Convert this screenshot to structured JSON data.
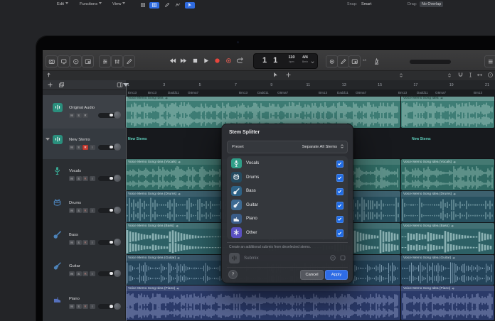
{
  "window": {
    "app": "Logic Pro"
  },
  "control_bar": {
    "transport": [
      "rewind",
      "fast-forward",
      "stop",
      "play",
      "record",
      "capture-record",
      "cycle"
    ],
    "lcd": {
      "position": "1 1",
      "tempo": "110",
      "tempo_unit": "bpm",
      "time_signature": "4/4",
      "key": "Bmin"
    },
    "count_in_label": "x4"
  },
  "menu_bar": {
    "menus": [
      "Edit",
      "Functions",
      "View"
    ],
    "snap_label": "Snap:",
    "snap_value": "Smart",
    "drag_label": "Drag:",
    "drag_value": "No Overlap"
  },
  "ruler": {
    "numbers": [
      "1",
      "3",
      "5",
      "7",
      "9",
      "11",
      "13",
      "15",
      "17",
      "19",
      "21"
    ]
  },
  "chord_track": {
    "labels": [
      "Em13",
      "Bm13",
      "Dadd11",
      "G6ma7",
      "Bm13",
      "Dadd11",
      "G6ma7",
      "Bm13",
      "Dadd11",
      "G6ma7",
      "Bm13",
      "Dadd11",
      "G6ma7",
      "Bm13"
    ]
  },
  "track_list": {
    "tracks": [
      {
        "name": "Original Audio",
        "icon": "audio",
        "tile_color": "#2a8f7d",
        "buttons": [
          "M",
          "S",
          "R"
        ],
        "selected": true
      },
      {
        "name": "New Stems",
        "icon": "audio",
        "tile_color": "#2a8f7d",
        "buttons": [
          "M",
          "S",
          "R",
          "I"
        ],
        "record_armed": true,
        "disclosure": true,
        "selected": true
      },
      {
        "name": "Vocals",
        "icon": "mic",
        "icon_color": "#38a893",
        "buttons": [
          "M",
          "S",
          "R",
          "I"
        ]
      },
      {
        "name": "Drums",
        "icon": "drum",
        "icon_color": "#4c82b8",
        "buttons": [
          "M",
          "S",
          "R",
          "I"
        ]
      },
      {
        "name": "Bass",
        "icon": "bass",
        "icon_color": "#4c82b8",
        "buttons": [
          "M",
          "S",
          "R",
          "I"
        ]
      },
      {
        "name": "Guitar",
        "icon": "guitar",
        "icon_color": "#4c82b8",
        "buttons": [
          "M",
          "S",
          "R",
          "I"
        ]
      },
      {
        "name": "Piano",
        "icon": "piano",
        "icon_color": "#5570bd",
        "buttons": [
          "M",
          "S",
          "R",
          "I"
        ]
      }
    ]
  },
  "arrange": {
    "rows": [
      {
        "label": "Voice Memo Song Idea",
        "color": "#3e7d75",
        "wave_color": "#a9cdc6"
      },
      {
        "label": "New Stems",
        "lane": true,
        "color": "#17191d",
        "text_color": "#5ecdbb"
      },
      {
        "label": "Voice Memo Song Idea (Vocals)",
        "color": "#2f6a63",
        "wave_color": "#9cc3bb"
      },
      {
        "label": "Voice Memo Song Idea (Drums)",
        "color": "#27505f",
        "wave_color": "#8fb2ba"
      },
      {
        "label": "Voice Memo Song Idea (Bass)",
        "color": "#2d6065",
        "wave_color": "#9cc0c1"
      },
      {
        "label": "Voice Memo Song Idea (Guitar)",
        "color": "#24445a",
        "wave_color": "#8aa8bd"
      },
      {
        "label": "Voice Memo Song Idea (Piano)",
        "color": "#2b3a69",
        "wave_color": "#95a2cd"
      }
    ]
  },
  "dialog": {
    "title": "Stem Splitter",
    "preset_label": "Preset",
    "preset_value": "Separate All Stems",
    "stems": [
      {
        "name": "Vocals",
        "icon": "mic",
        "color": "#2f9e88",
        "checked": true
      },
      {
        "name": "Drums",
        "icon": "drum",
        "color": "#254b60",
        "checked": true
      },
      {
        "name": "Bass",
        "icon": "bass",
        "color": "#2e6286",
        "checked": true
      },
      {
        "name": "Guitar",
        "icon": "guitar",
        "color": "#3d6a93",
        "checked": true
      },
      {
        "name": "Piano",
        "icon": "piano",
        "color": "#3a5c88",
        "checked": true
      },
      {
        "name": "Other",
        "icon": "other",
        "color": "#5a50c2",
        "checked": true
      }
    ],
    "submix_note": "Create an additional submix from deselected stems.",
    "submix_label": "Submix",
    "help_label": "?",
    "cancel_label": "Cancel",
    "apply_label": "Apply",
    "accent_color": "#2e6ce6",
    "checkbox_color": "#1f6be4"
  }
}
